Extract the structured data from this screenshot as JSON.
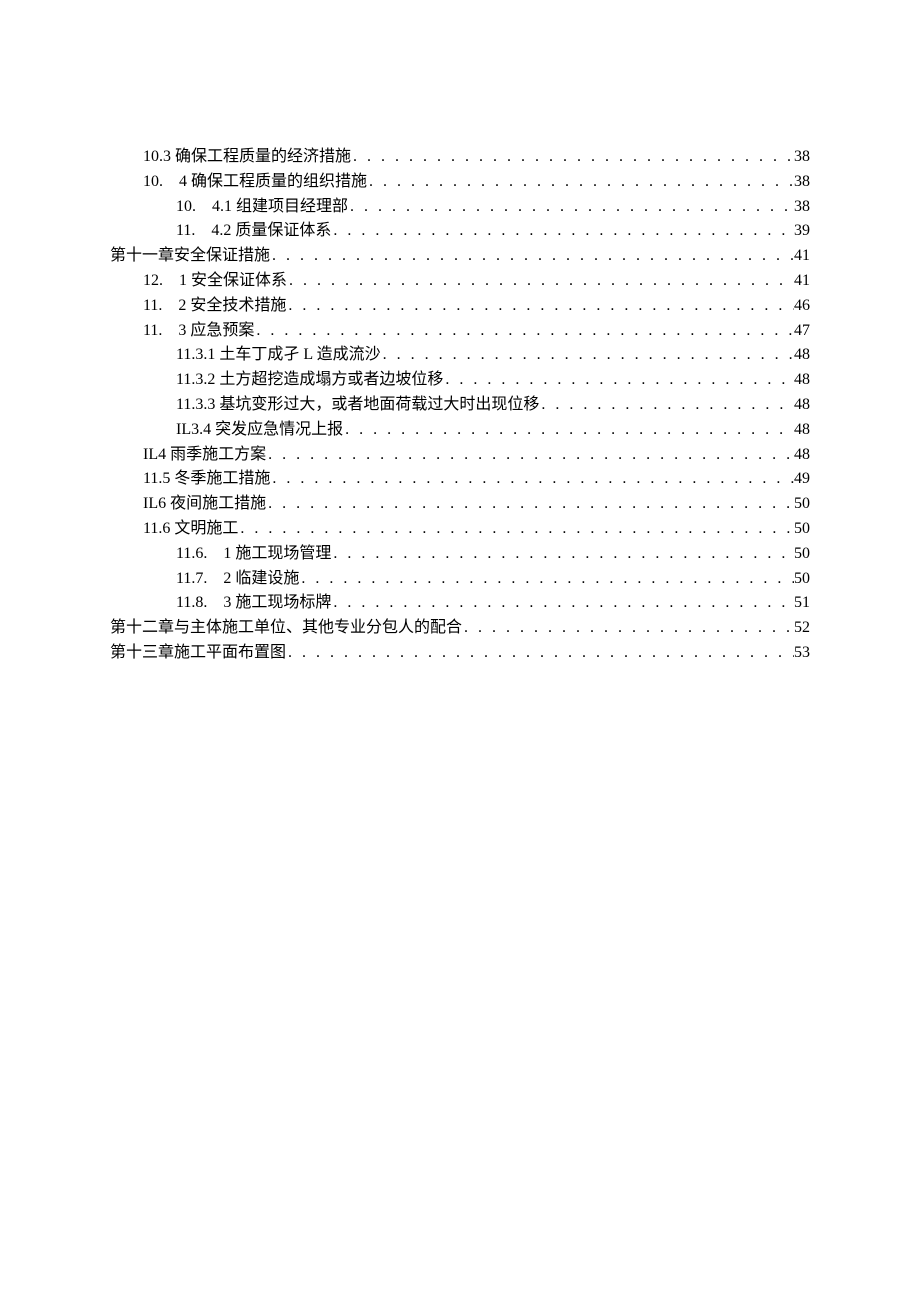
{
  "toc": [
    {
      "indent": 1,
      "label": "10.3 确保工程质量的经济措施",
      "page": "38"
    },
    {
      "indent": 1,
      "label": "10.　4 确保工程质量的组织措施 ",
      "page": "38"
    },
    {
      "indent": 2,
      "label": "10.　4.1 组建项目经理部 ",
      "page": "38"
    },
    {
      "indent": 2,
      "label": "11.　4.2 质量保证体系 ",
      "page": "39"
    },
    {
      "indent": 0,
      "label": "第十一章安全保证措施",
      "page": "41"
    },
    {
      "indent": 1,
      "label": "12.　1 安全保证体系 ",
      "page": "41"
    },
    {
      "indent": 1,
      "label": "11.　2 安全技术措施 ",
      "page": "46"
    },
    {
      "indent": 1,
      "label": "11.　3 应急预案 ",
      "page": "47"
    },
    {
      "indent": 2,
      "label": "11.3.1 土车丁成孑 L 造成流沙 ",
      "page": "48"
    },
    {
      "indent": 2,
      "label": "11.3.2 土方超挖造成塌方或者边坡位移",
      "page": "48"
    },
    {
      "indent": 2,
      "label": "11.3.3 基坑变形过大，或者地面荷载过大时出现位移",
      "page": "48"
    },
    {
      "indent": 2,
      "label": "IL3.4 突发应急情况上报 ",
      "page": "48"
    },
    {
      "indent": 1,
      "label": "IL4 雨季施工方案 ",
      "page": "48"
    },
    {
      "indent": 1,
      "label": "11.5 冬季施工措施",
      "page": "49"
    },
    {
      "indent": 1,
      "label": "IL6 夜间施工措施 ",
      "page": "50"
    },
    {
      "indent": 1,
      "label": "11.6 文明施工",
      "page": "50"
    },
    {
      "indent": 2,
      "label": "11.6.　1 施工现场管理",
      "page": "50"
    },
    {
      "indent": 2,
      "label": "11.7.　2 临建设施",
      "page": "50"
    },
    {
      "indent": 2,
      "label": "11.8.　3 施工现场标牌",
      "page": "51"
    },
    {
      "indent": 0,
      "label": "第十二章与主体施工单位、其他专业分包人的配合 ",
      "page": "52"
    },
    {
      "indent": 0,
      "label": "第十三章施工平面布置图",
      "page": "53"
    }
  ]
}
